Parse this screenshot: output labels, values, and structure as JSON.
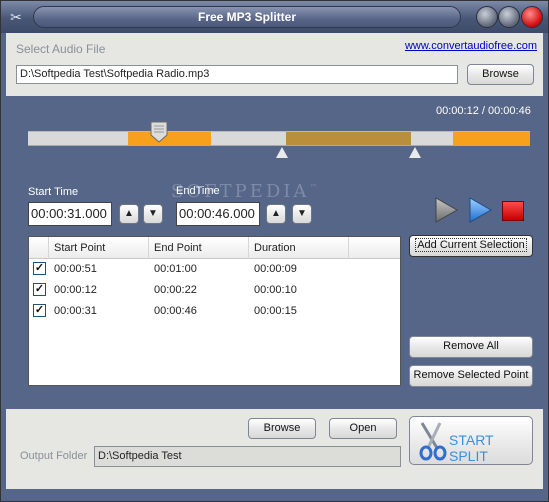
{
  "window": {
    "title": "Free MP3 Splitter"
  },
  "source": {
    "label": "Select Audio File",
    "link": "www.convertaudiofree.com",
    "file_path": "D:\\Softpedia Test\\Softpedia Radio.mp3",
    "browse_label": "Browse"
  },
  "player": {
    "time_readout": "00:00:12 / 00:00:46",
    "position_fraction": 0.26,
    "watermark": "SOFTPEDIA",
    "watermark_mark": "™"
  },
  "selection": {
    "start_label": "Start Time",
    "end_label": "EndTime",
    "start_value": "00:00:31.000",
    "end_value": "00:00:46.000"
  },
  "list": {
    "columns": [
      "Start Point",
      "End Point",
      "Duration"
    ],
    "rows": [
      {
        "checked": true,
        "start": "00:00:51",
        "end": "00:01:00",
        "duration": "00:00:09"
      },
      {
        "checked": true,
        "start": "00:00:12",
        "end": "00:00:22",
        "duration": "00:00:10"
      },
      {
        "checked": true,
        "start": "00:00:31",
        "end": "00:00:46",
        "duration": "00:00:15"
      }
    ]
  },
  "actions": {
    "add_selection": "Add Current Selection",
    "remove_all": "Remove All",
    "remove_selected": "Remove Selected Point"
  },
  "output": {
    "browse_label": "Browse",
    "open_label": "Open",
    "folder_label": "Output Folder",
    "folder_path": "D:\\Softpedia Test",
    "start_split": "START SPLIT"
  },
  "colors": {
    "accent_orange": "#f7a01c",
    "selection_segment": "#b98f3e",
    "play_blue": "#3a8fe0",
    "stop_red": "#d10000"
  }
}
